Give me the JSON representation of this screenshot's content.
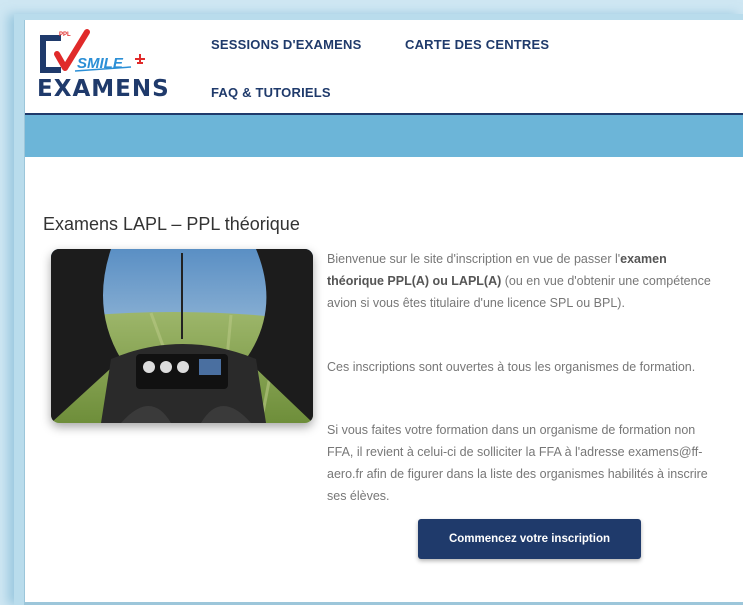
{
  "logo": {
    "top_text": "PPL",
    "script_text": "SMILE",
    "brand_text": "EXAMENS"
  },
  "nav": {
    "sessions": "SESSIONS D'EXAMENS",
    "carte": "CARTE DES CENTRES",
    "faq": "FAQ & TUTORIELS"
  },
  "main": {
    "title": "Examens LAPL – PPL théorique",
    "para1_a": "Bienvenue sur le site d'inscription en vue de passer l'",
    "para1_bold": "examen théorique PPL(A) ou LAPL(A)",
    "para1_b": " (ou en vue d'obtenir une compétence avion si vous êtes titulaire d'une licence SPL ou BPL).",
    "para2": "Ces inscriptions sont ouvertes à tous les organismes de formation.",
    "para3": "Si vous faites votre formation dans un organisme de formation non FFA, il revient à celui-ci de solliciter la FFA à l'adresse examens@ff-aero.fr afin de figurer dans la liste des organismes habilités à inscrire ses élèves.",
    "cta_label": "Commencez votre inscription"
  },
  "colors": {
    "navy": "#1f3a6b",
    "banner_blue": "#6cb5d8",
    "logo_red": "#e02a2a"
  }
}
